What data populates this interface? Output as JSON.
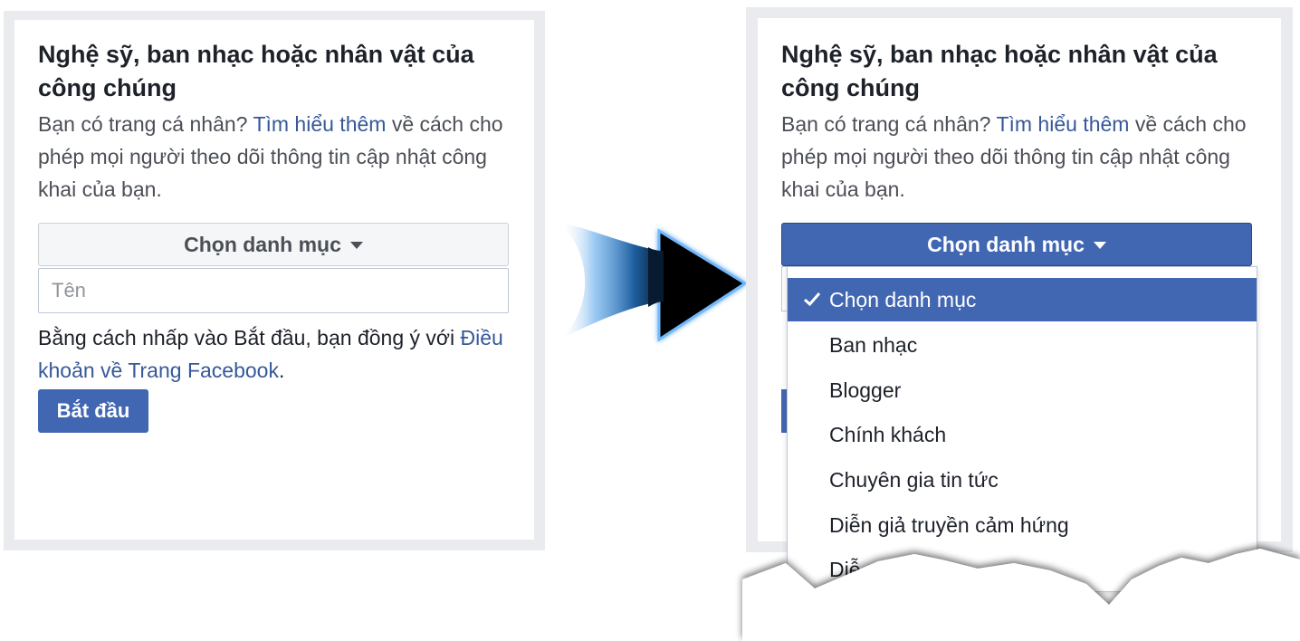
{
  "left_panel": {
    "title": "Nghệ sỹ, ban nhạc hoặc nhân vật của công chúng",
    "desc_prefix": "Bạn có trang cá nhân? ",
    "desc_link": "Tìm hiểu thêm",
    "desc_suffix": " về cách cho phép mọi người theo dõi thông tin cập nhật công khai của bạn.",
    "select_label": "Chọn danh mục",
    "name_placeholder": "Tên",
    "terms_prefix": "Bằng cách nhấp vào Bắt đầu, bạn đồng ý với ",
    "terms_link": "Điều khoản về Trang Facebook",
    "terms_suffix": ".",
    "start_button": "Bắt đầu"
  },
  "right_panel": {
    "title": "Nghệ sỹ, ban nhạc hoặc nhân vật của công chúng",
    "desc_prefix": "Bạn có trang cá nhân? ",
    "desc_link": "Tìm hiểu thêm",
    "desc_suffix": " về cách cho phép mọi người theo dõi thông tin cập nhật công khai của bạn.",
    "select_label": "Chọn danh mục",
    "dropdown_items": [
      "Chọn danh mục",
      "Ban nhạc",
      "Blogger",
      "Chính khách",
      "Chuyên gia tin tức",
      "Diễn giả truyền cảm hứng",
      "Diễ"
    ],
    "selected_index": 0
  },
  "colors": {
    "brand_blue": "#4267b2",
    "link_blue": "#365899",
    "frame_gray": "#e9ebee"
  },
  "icons": {
    "arrow": "right-arrow-icon",
    "check": "check-icon",
    "caret": "caret-down-icon"
  }
}
